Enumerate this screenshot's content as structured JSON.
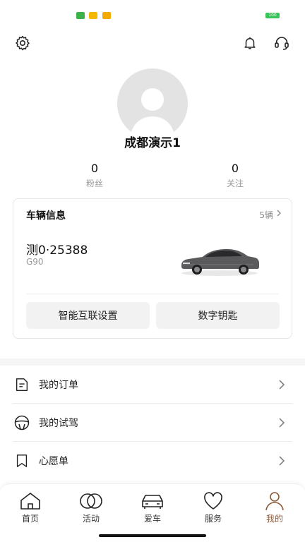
{
  "status_bar": {
    "icons": [
      "app-notification-icon",
      "message-icon",
      "weibo-icon"
    ],
    "icon_colors": [
      "#3cb34a",
      "#f5b800",
      "#f2a900"
    ],
    "battery": "100"
  },
  "header": {
    "settings_icon": "gear-icon",
    "notification_icon": "bell-icon",
    "support_icon": "headset-icon"
  },
  "profile": {
    "name": "成都演示1",
    "followers_count": "0",
    "followers_label": "粉丝",
    "following_count": "0",
    "following_label": "关注"
  },
  "vehicle_card": {
    "title": "车辆信息",
    "count_label": "5辆",
    "plate": "测0·25388",
    "model": "G90",
    "button_smart": "智能互联设置",
    "button_key": "数字钥匙"
  },
  "menu": {
    "items": [
      {
        "label": "我的订单",
        "icon": "document-icon"
      },
      {
        "label": "我的试驾",
        "icon": "steering-wheel-icon"
      },
      {
        "label": "心愿单",
        "icon": "bookmark-icon"
      }
    ]
  },
  "tabbar": {
    "tabs": [
      {
        "label": "首页",
        "icon": "home-icon"
      },
      {
        "label": "活动",
        "icon": "rings-icon"
      },
      {
        "label": "爱车",
        "icon": "car-icon"
      },
      {
        "label": "服务",
        "icon": "heart-icon"
      },
      {
        "label": "我的",
        "icon": "person-icon",
        "active": true
      }
    ],
    "active_color": "#8a5a3c"
  }
}
